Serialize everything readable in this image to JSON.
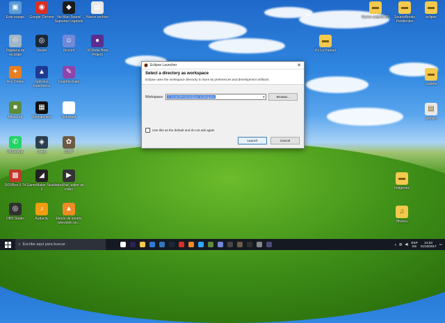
{
  "desktop": {
    "icons": [
      {
        "label": "Este equipo",
        "icon": "computer-icon",
        "color": "#5b9bd5",
        "glyph": "▣"
      },
      {
        "label": "Google Chrome",
        "icon": "chrome-icon",
        "color": "#d93025",
        "glyph": "◉"
      },
      {
        "label": "No Man Sound Supreme Legends",
        "icon": "game-icon",
        "color": "#1b1b1b",
        "glyph": "◆"
      },
      {
        "label": "Nuevo archivo",
        "icon": "document-icon",
        "color": "#e8e8e8",
        "glyph": "▤"
      },
      {
        "label": "Papelera de reciclaje",
        "icon": "recycle-bin-icon",
        "color": "#9fb7c9",
        "glyph": "♲"
      },
      {
        "label": "Steam",
        "icon": "steam-icon",
        "color": "#1b2838",
        "glyph": "◎"
      },
      {
        "label": "Discord",
        "icon": "discord-icon",
        "color": "#7289da",
        "glyph": "☺"
      },
      {
        "label": "OCDefer Beta Project",
        "icon": "app-icon",
        "color": "#5c2d91",
        "glyph": "●"
      },
      {
        "label": "Ace Online",
        "icon": "game-icon",
        "color": "#e67e22",
        "glyph": "✦"
      },
      {
        "label": "GeForce Experience",
        "icon": "nvidia-icon",
        "color": "#1f3a93",
        "glyph": "▲"
      },
      {
        "label": "GraphicsGale",
        "icon": "paint-icon",
        "color": "#8e44ad",
        "glyph": "✎"
      },
      {
        "label": "Minecraft",
        "icon": "minecraft-icon",
        "color": "#5d8c3a",
        "glyph": "■"
      },
      {
        "label": "Boltcatchers",
        "icon": "app-icon",
        "color": "#111111",
        "glyph": "▦"
      },
      {
        "label": "Unlocked",
        "icon": "blank-icon",
        "color": "#ffffff",
        "glyph": ""
      },
      {
        "label": "WhatsApp",
        "icon": "whatsapp-icon",
        "color": "#25d366",
        "glyph": "✆"
      },
      {
        "label": "Juego",
        "icon": "game-icon",
        "color": "#2c3e50",
        "glyph": "◈"
      },
      {
        "label": "GIMP",
        "icon": "gimp-icon",
        "color": "#6b5b45",
        "glyph": "✿"
      },
      {
        "label": "DOSBox 0.74",
        "icon": "dosbox-icon",
        "color": "#c0392b",
        "glyph": "▩"
      },
      {
        "label": "GameMaker Studio 2",
        "icon": "gamemaker-icon",
        "color": "#222222",
        "glyph": "◢"
      },
      {
        "label": "VideoPad, editor de vídeo",
        "icon": "video-icon",
        "color": "#333333",
        "glyph": "▶"
      },
      {
        "label": "OBS Studio",
        "icon": "obs-icon",
        "color": "#303030",
        "glyph": "◎"
      },
      {
        "label": "Audacity",
        "icon": "audacity-icon",
        "color": "#f39c12",
        "glyph": "♪"
      },
      {
        "label": "Efecto de sonido televisión se...",
        "icon": "vlc-icon",
        "color": "#f08a24",
        "glyph": "▲"
      }
    ],
    "right_icons": [
      {
        "label": "Nueva carpeta (2)",
        "icon": "folder-icon",
        "color": "#f3c94e",
        "glyph": "▬"
      },
      {
        "label": "SourceBooks Pendientes",
        "icon": "folder-icon",
        "color": "#f3c94e",
        "glyph": "▬"
      },
      {
        "label": "Ps La Paneel",
        "icon": "folder-icon",
        "color": "#f3c94e",
        "glyph": "▬"
      },
      {
        "label": "eclipse",
        "icon": "folder-icon",
        "color": "#f3c94e",
        "glyph": "▬"
      },
      {
        "label": "carpeta",
        "icon": "folder-icon",
        "color": "#f3c94e",
        "glyph": "▬"
      },
      {
        "label": "archivo",
        "icon": "document-icon",
        "color": "#e8e8e8",
        "glyph": "▤"
      },
      {
        "label": "Imágenes",
        "icon": "image-icon",
        "color": "#f3c94e",
        "glyph": "▬"
      },
      {
        "label": "Música",
        "icon": "music-folder-icon",
        "color": "#f3c94e",
        "glyph": "♫"
      }
    ]
  },
  "dialog": {
    "title": "Eclipse Launcher",
    "heading": "Select a directory as workspace",
    "description": "Eclipse uses the workspace directory to store its preferences and development artifacts.",
    "workspace_label": "Workspace:",
    "workspace_value": "C:\\Users\\Pons\\eclipse-workspace",
    "browse_label": "Browse...",
    "default_checkbox_label": "Use this as the default and do not ask again",
    "launch_label": "Launch",
    "cancel_label": "Cancel"
  },
  "taskbar": {
    "search_placeholder": "Escribe aquí para buscar",
    "apps": [
      {
        "icon": "task-view-icon",
        "color": "#ffffff"
      },
      {
        "icon": "eclipse-icon",
        "color": "#2c2255"
      },
      {
        "icon": "file-explorer-icon",
        "color": "#f3c94e"
      },
      {
        "icon": "store-icon",
        "color": "#2b7cd3"
      },
      {
        "icon": "edge-icon",
        "color": "#3277bc"
      },
      {
        "icon": "steam-icon",
        "color": "#1b2838"
      },
      {
        "icon": "chrome-icon",
        "color": "#d93025"
      },
      {
        "icon": "vlc-icon",
        "color": "#f08a24"
      },
      {
        "icon": "photoshop-icon",
        "color": "#31a8ff"
      },
      {
        "icon": "minecraft-icon",
        "color": "#5d8c3a"
      },
      {
        "icon": "discord-icon",
        "color": "#7289da"
      },
      {
        "icon": "gamemaker-icon",
        "color": "#444444"
      },
      {
        "icon": "gimp-icon",
        "color": "#6b5b45"
      },
      {
        "icon": "obs-icon",
        "color": "#303030"
      },
      {
        "icon": "settings-icon",
        "color": "#888888"
      },
      {
        "icon": "eclipse-running-icon",
        "color": "#4a4a7a"
      }
    ],
    "language": "ESP",
    "region": "ES",
    "time": "21:03",
    "date": "21/10/2017"
  }
}
